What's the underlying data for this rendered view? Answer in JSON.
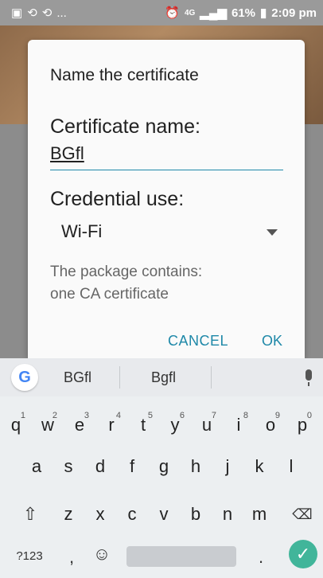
{
  "status_bar": {
    "left_icons": [
      "image-icon",
      "sync-icon",
      "sync-icon",
      "more-icon"
    ],
    "left_text": "...",
    "battery": "61%",
    "time": "2:09 pm",
    "network": "4G"
  },
  "dialog": {
    "title": "Name the certificate",
    "certificate_label": "Certificate name:",
    "certificate_value": "BGfl",
    "credential_label": "Credential use:",
    "credential_value": "Wi-Fi",
    "package_line1": "The package contains:",
    "package_line2": "one CA certificate",
    "cancel_label": "CANCEL",
    "ok_label": "OK"
  },
  "keyboard": {
    "suggestions": [
      "BGfl",
      "Bgfl"
    ],
    "row1": [
      {
        "k": "q",
        "h": "1"
      },
      {
        "k": "w",
        "h": "2"
      },
      {
        "k": "e",
        "h": "3"
      },
      {
        "k": "r",
        "h": "4"
      },
      {
        "k": "t",
        "h": "5"
      },
      {
        "k": "y",
        "h": "6"
      },
      {
        "k": "u",
        "h": "7"
      },
      {
        "k": "i",
        "h": "8"
      },
      {
        "k": "o",
        "h": "9"
      },
      {
        "k": "p",
        "h": "0"
      }
    ],
    "row2": [
      "a",
      "s",
      "d",
      "f",
      "g",
      "h",
      "j",
      "k",
      "l"
    ],
    "row3": [
      "z",
      "x",
      "c",
      "v",
      "b",
      "n",
      "m"
    ],
    "symbols_label": "?123",
    "comma": ",",
    "period": ".",
    "accent_color": "#1e88a8",
    "enter_color": "#41b59a"
  }
}
